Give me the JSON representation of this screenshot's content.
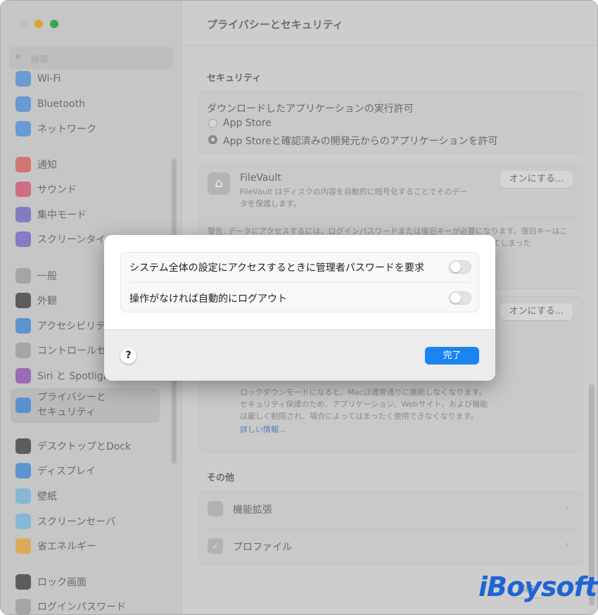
{
  "window": {
    "title": "プライバシーとセキュリティ"
  },
  "sidebar": {
    "search_placeholder": "検索",
    "items": [
      {
        "label": "Wi-Fi",
        "icon": "wifi-icon",
        "color": "#4a8bd6"
      },
      {
        "label": "Bluetooth",
        "icon": "bluetooth-icon",
        "color": "#4a8bd6"
      },
      {
        "label": "ネットワーク",
        "icon": "globe-icon",
        "color": "#4a8bd6"
      },
      {
        "label": "通知",
        "icon": "bell-icon",
        "color": "#d25a55"
      },
      {
        "label": "サウンド",
        "icon": "speaker-icon",
        "color": "#d2506b"
      },
      {
        "label": "集中モード",
        "icon": "moon-icon",
        "color": "#6e62c4"
      },
      {
        "label": "スクリーンタイム",
        "icon": "hourglass-icon",
        "color": "#6e62c4"
      },
      {
        "label": "一般",
        "icon": "gear-icon",
        "color": "#9a9a9a"
      },
      {
        "label": "外観",
        "icon": "appearance-icon",
        "color": "#3a3a3a"
      },
      {
        "label": "アクセシビリティ",
        "icon": "accessibility-icon",
        "color": "#3b82d6"
      },
      {
        "label": "コントロールセンター",
        "icon": "control-center-icon",
        "color": "#9a9a9a"
      },
      {
        "label": "Siri と Spotlight",
        "icon": "siri-icon",
        "color": "#8a4fb0"
      },
      {
        "label": "プライバシーと\nセキュリティ",
        "icon": "hand-icon",
        "color": "#3b82d6",
        "selected": true
      },
      {
        "label": "デスクトップとDock",
        "icon": "dock-icon",
        "color": "#3a3a3a"
      },
      {
        "label": "ディスプレイ",
        "icon": "sun-icon",
        "color": "#3b82d6"
      },
      {
        "label": "壁紙",
        "icon": "wallpaper-icon",
        "color": "#6fb3d8"
      },
      {
        "label": "スクリーンセーバ",
        "icon": "screensaver-icon",
        "color": "#6fb3d8"
      },
      {
        "label": "省エネルギー",
        "icon": "bulb-icon",
        "color": "#e0a034"
      },
      {
        "label": "ロック画面",
        "icon": "lock-screen-icon",
        "color": "#3a3a3a"
      },
      {
        "label": "ログインパスワード",
        "icon": "lock-icon",
        "color": "#9a9a9a"
      }
    ]
  },
  "main": {
    "security_heading": "セキュリティ",
    "download_label": "ダウンロードしたアプリケーションの実行許可",
    "radio_options": [
      {
        "label": "App Store",
        "selected": false
      },
      {
        "label": "App Storeと確認済みの開発元からのアプリケーションを許可",
        "selected": true
      }
    ],
    "filevault": {
      "title": "FileVault",
      "desc": "FileVault はディスクの内容を自動的に暗号化することでそのデータを保護します。",
      "button": "オンにする...",
      "warning": "警告: データにアクセスするには、ログインパスワードまたは復旧キーが必要になります。復旧キーはこの設定の一部として自動的に生成されます。パスワードと復旧キーの両方とも忘れてしまった"
    },
    "lockdown": {
      "button": "オンにする...",
      "desc": "ロックダウンモードになると、Macは通常通りに機能しなくなります。セキュリティ保護のため、アプリケーション、Webサイト、および機能は厳しく制限され、場合によってはまったく使用できなくなります。",
      "link": "詳しい情報..."
    },
    "other_heading": "その他",
    "other_items": [
      {
        "label": "機能拡張",
        "icon": "extension-icon"
      },
      {
        "label": "プロファイル",
        "icon": "profile-icon"
      }
    ],
    "advanced_button": "詳細"
  },
  "dialog": {
    "options": [
      {
        "label": "システム全体の設定にアクセスするときに管理者パスワードを要求",
        "on": false
      },
      {
        "label": "操作がなければ自動的にログアウト",
        "on": false
      }
    ],
    "help": "?",
    "done": "完了",
    "accent": "#1a84f0"
  },
  "watermark": "iBoysoft"
}
